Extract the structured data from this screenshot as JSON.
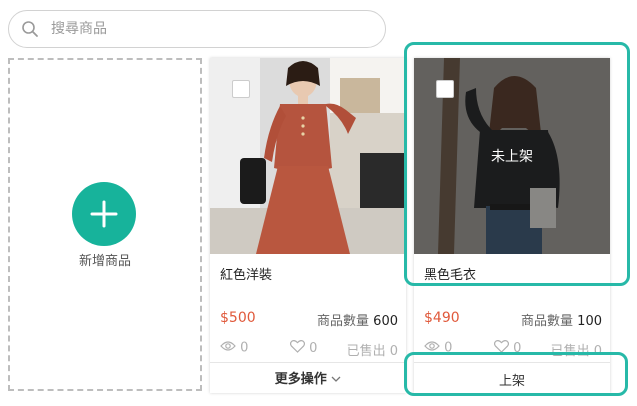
{
  "search": {
    "placeholder": "搜尋商品",
    "value": ""
  },
  "add_product": {
    "label": "新增商品"
  },
  "products": [
    {
      "name": "紅色洋裝",
      "price": "$500",
      "quantity_label": "商品數量",
      "quantity": "600",
      "views": "0",
      "likes": "0",
      "sold_label": "已售出",
      "sold": "0",
      "action_label": "更多操作",
      "listed": true
    },
    {
      "name": "黑色毛衣",
      "price": "$490",
      "quantity_label": "商品數量",
      "quantity": "100",
      "views": "0",
      "likes": "0",
      "sold_label": "已售出",
      "sold": "0",
      "status_overlay": "未上架",
      "action_label": "上架",
      "listed": false
    }
  ],
  "colors": {
    "accent": "#17b39b",
    "highlight": "#27b9a8",
    "price": "#e0593b"
  }
}
